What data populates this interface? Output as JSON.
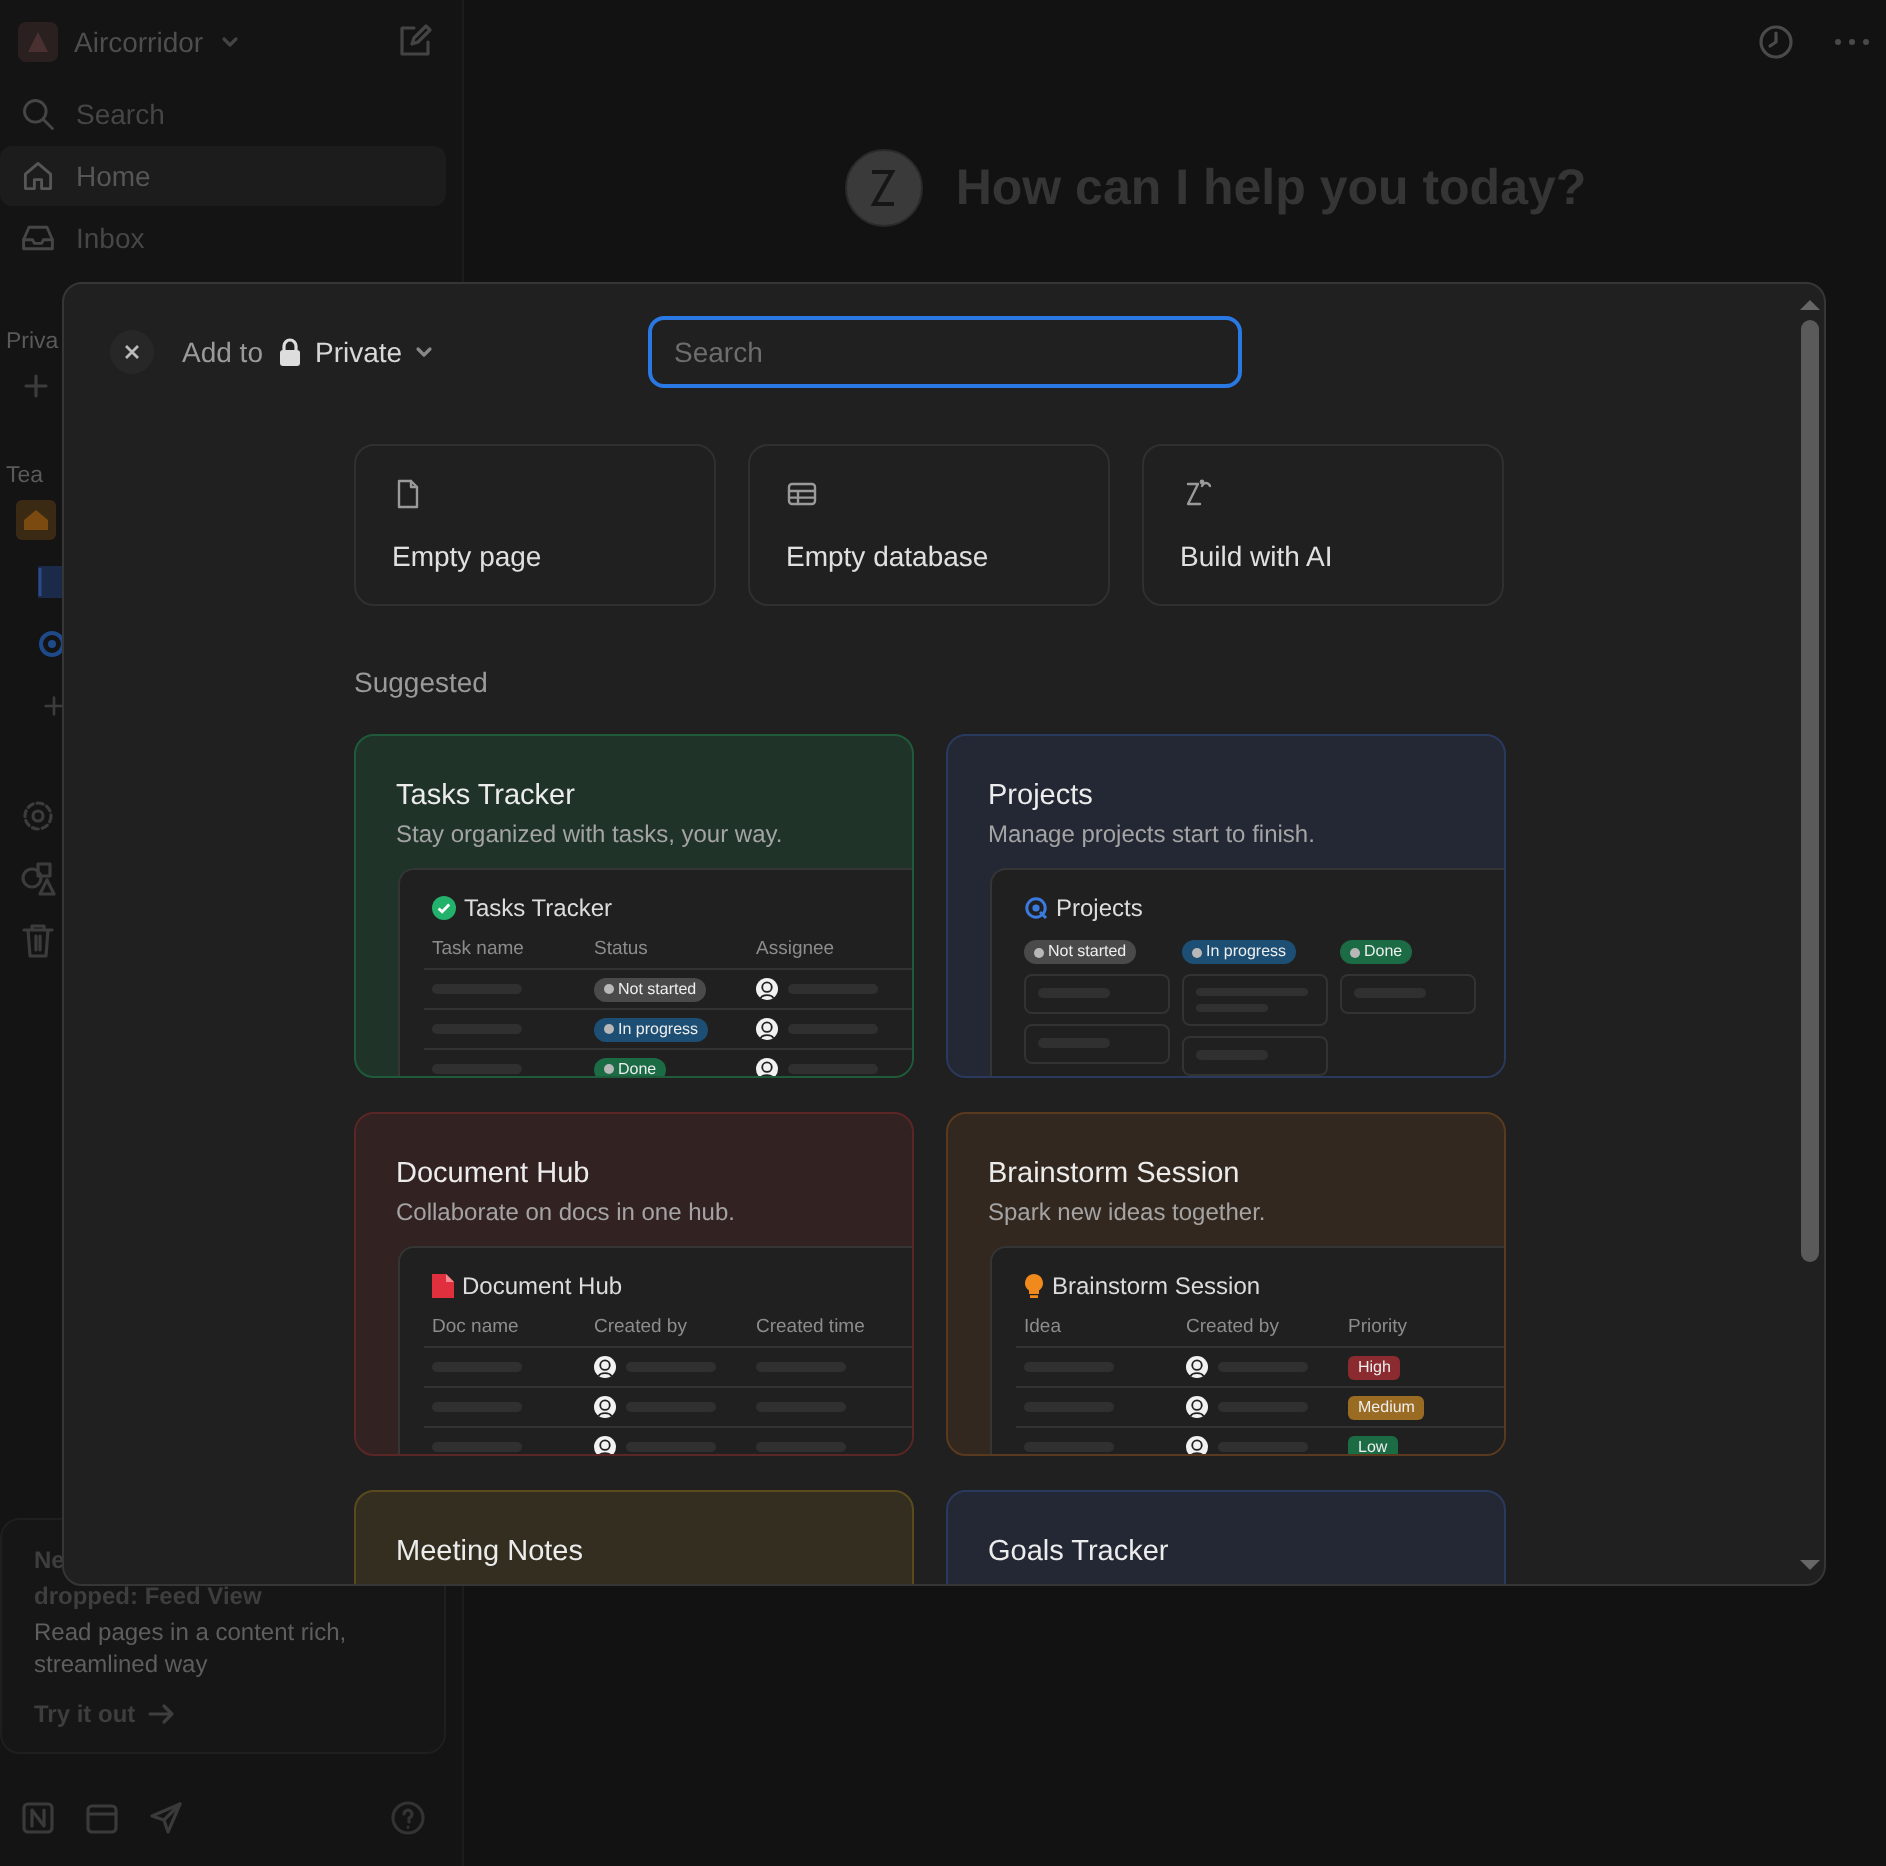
{
  "sidebar": {
    "workspace": "Aircorridor",
    "items": [
      {
        "kind": "search",
        "label": "Search",
        "selected": false
      },
      {
        "kind": "home",
        "label": "Home",
        "selected": true
      },
      {
        "kind": "inbox",
        "label": "Inbox",
        "selected": false
      }
    ],
    "section_1": "Priva",
    "section_2": "Tea",
    "promo": {
      "title_line_1": "Ne",
      "title_line_2": "dropped: Feed View",
      "body": "Read pages in a content rich, streamlined way",
      "action": "Try it out"
    }
  },
  "main": {
    "heading": "How can I help you today?"
  },
  "dialog": {
    "add_to_label": "Add to",
    "location": "Private",
    "search": {
      "placeholder": "Search"
    },
    "quick_actions": [
      {
        "kind": "page",
        "label": "Empty page"
      },
      {
        "kind": "database",
        "label": "Empty database"
      },
      {
        "kind": "ai",
        "label": "Build with AI"
      }
    ],
    "section_title": "Suggested",
    "templates": [
      {
        "title": "Tasks Tracker",
        "description": "Stay organized with tasks, your way.",
        "color": "#1f5a3a",
        "preview": {
          "kind": "table",
          "title": "Tasks Tracker",
          "columns": [
            "Task name",
            "Status",
            "Assignee"
          ],
          "rows": [
            [
              {
                "kind": "bar"
              },
              {
                "kind": "status",
                "text": "Not started",
                "color": "#4a4a4a"
              },
              {
                "kind": "person"
              }
            ],
            [
              {
                "kind": "bar"
              },
              {
                "kind": "status",
                "text": "In progress",
                "color": "#1d4e73"
              },
              {
                "kind": "person"
              }
            ],
            [
              {
                "kind": "bar"
              },
              {
                "kind": "status",
                "text": "Done",
                "color": "#1b6b45"
              },
              {
                "kind": "person"
              }
            ]
          ]
        }
      },
      {
        "title": "Projects",
        "description": "Manage projects start to finish.",
        "color": "#2a3a5e",
        "preview": {
          "kind": "board",
          "title": "Projects",
          "columns": [
            {
              "text": "Not started",
              "color": "#4a4a4a",
              "cards": [
                {
                  "kind": "single"
                },
                {
                  "kind": "single"
                }
              ]
            },
            {
              "text": "In progress",
              "color": "#1d4e73",
              "cards": [
                {
                  "kind": "double"
                },
                {
                  "kind": "single"
                }
              ]
            },
            {
              "text": "Done",
              "color": "#1b6b45",
              "cards": [
                {
                  "kind": "single"
                }
              ]
            }
          ]
        }
      },
      {
        "title": "Document Hub",
        "description": "Collaborate on docs in one hub.",
        "color": "#5a2626",
        "preview": {
          "kind": "table",
          "title": "Document Hub",
          "columns": [
            "Doc name",
            "Created by",
            "Created time"
          ],
          "rows": [
            [
              {
                "kind": "bar"
              },
              {
                "kind": "person"
              },
              {
                "kind": "bar"
              }
            ],
            [
              {
                "kind": "bar"
              },
              {
                "kind": "person"
              },
              {
                "kind": "bar"
              }
            ],
            [
              {
                "kind": "bar"
              },
              {
                "kind": "person"
              },
              {
                "kind": "bar"
              }
            ]
          ]
        }
      },
      {
        "title": "Brainstorm Session",
        "description": "Spark new ideas together.",
        "color": "#5a3a1e",
        "preview": {
          "kind": "table",
          "title": "Brainstorm Session",
          "columns": [
            "Idea",
            "Created by",
            "Priority"
          ],
          "rows": [
            [
              {
                "kind": "bar"
              },
              {
                "kind": "person"
              },
              {
                "kind": "priority",
                "text": "High",
                "color": "#8b2a2f"
              }
            ],
            [
              {
                "kind": "bar"
              },
              {
                "kind": "person"
              },
              {
                "kind": "priority",
                "text": "Medium",
                "color": "#9a6b22"
              }
            ],
            [
              {
                "kind": "bar"
              },
              {
                "kind": "person"
              },
              {
                "kind": "priority",
                "text": "Low",
                "color": "#1b6b45"
              }
            ]
          ]
        }
      },
      {
        "title": "Meeting Notes",
        "color": "#5a4a1e"
      },
      {
        "title": "Goals Tracker",
        "color": "#2a3a5e"
      }
    ]
  }
}
